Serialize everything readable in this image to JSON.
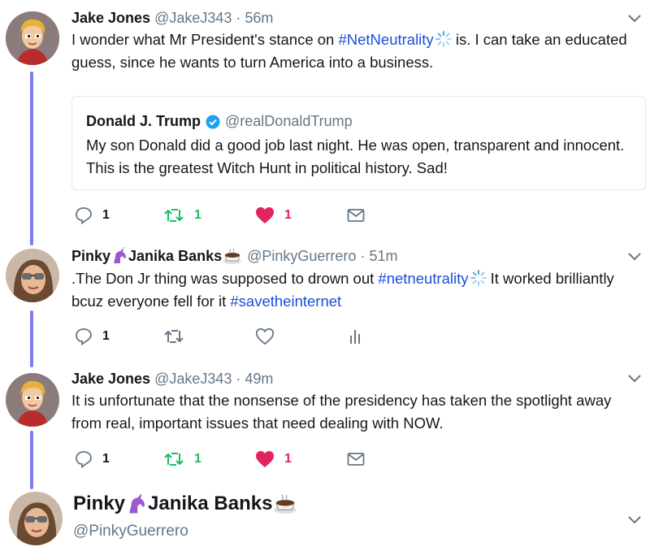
{
  "tweets": [
    {
      "name": "Jake Jones",
      "handle": "@JakeJ343",
      "time": "56m",
      "text_before": "I wonder what Mr President's stance on ",
      "hashtag1": "#NetNeutrality",
      "text_after": " is. I can take an educated guess, since he wants to turn America into a business.",
      "quote": {
        "name": "Donald J. Trump",
        "handle": "@realDonaldTrump",
        "text": "My son Donald did a good job last night. He was open, transparent and innocent. This is the greatest Witch Hunt in political history. Sad!"
      },
      "actions": {
        "replies": "1",
        "retweets": "1",
        "likes": "1"
      }
    },
    {
      "name_part1": "Pinky",
      "name_part2": "Janika Banks",
      "handle": "@PinkyGuerrero",
      "time": "51m",
      "text_before": ".The Don Jr thing was supposed to drown out ",
      "hashtag1": "#netneutrality",
      "text_middle": " It worked brilliantly bcuz everyone fell for it ",
      "hashtag2": "#savetheinternet",
      "actions": {
        "replies": "1"
      }
    },
    {
      "name": "Jake Jones",
      "handle": "@JakeJ343",
      "time": "49m",
      "text": "It is unfortunate that the nonsense of the presidency has taken the spotlight away from real, important issues that need dealing with NOW.",
      "actions": {
        "replies": "1",
        "retweets": "1",
        "likes": "1"
      }
    }
  ],
  "reply_target": {
    "name_part1": "Pinky",
    "name_part2": "Janika Banks",
    "handle": "@PinkyGuerrero"
  },
  "separator": "·",
  "colors": {
    "thread_line": "#7c7cf5",
    "hashtag": "#1b4fd8",
    "retweet": "#17bf63",
    "like": "#e0245e",
    "muted": "#657786"
  },
  "icons": [
    "chevron-down-icon",
    "reply-icon",
    "retweet-icon",
    "heart-icon",
    "envelope-icon",
    "analytics-icon",
    "verified-badge-icon",
    "unicorn-emoji",
    "coffee-emoji",
    "loading-spinner-icon"
  ]
}
